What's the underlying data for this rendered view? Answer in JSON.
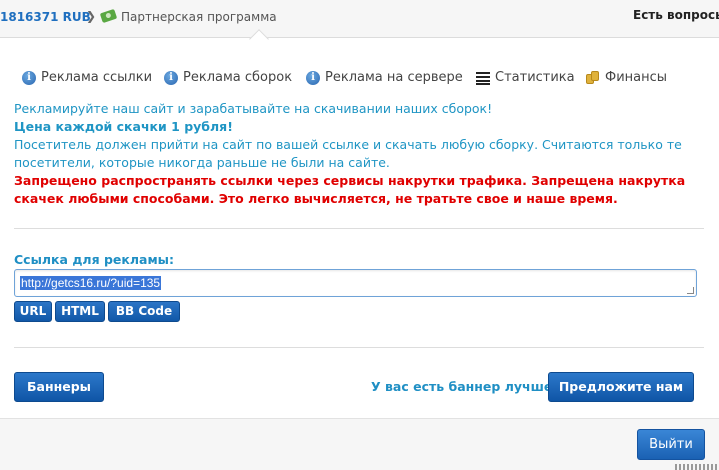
{
  "header": {
    "balance": "1816371 RUB",
    "separator": "❯",
    "breadcrumb_label": "Партнерская программа",
    "question_link": "Есть вопросы"
  },
  "tabs": [
    {
      "label": "Реклама ссылки",
      "icon": "info-icon"
    },
    {
      "label": "Реклама сборок",
      "icon": "info-icon"
    },
    {
      "label": "Реклама на сервере",
      "icon": "info-icon"
    },
    {
      "label": "Статистика",
      "icon": "list-icon"
    },
    {
      "label": "Финансы",
      "icon": "coins-icon"
    }
  ],
  "info": {
    "line1": "Рекламируйте наш сайт и зарабатывайте на скачивании наших сборок!",
    "line2": "Цена каждой скачки 1 рубля!",
    "line3": "Посетитель должен прийти на сайт по вашей ссылке и скачать любую сборку. Считаются только те посетители, которые никогда раньше не были на сайте.",
    "warning": "Запрещено распространять ссылки через сервисы накрутки трафика. Запрещена накрутка скачек любыми способами. Это легко вычисляется, не тратьте свое и наше время."
  },
  "link": {
    "label": "Ссылка для рекламы:",
    "value": "http://getcs16.ru/?uid=135"
  },
  "format_buttons": {
    "url": "URL",
    "html": "HTML",
    "bbcode": "BB Code"
  },
  "banners": {
    "button": "Баннеры",
    "question": "У вас есть баннер лучше?",
    "suggest_button": "Предложите нам"
  },
  "footer": {
    "exit_button": "Выйти"
  },
  "colors": {
    "accent_blue": "#1f95c4",
    "button_blue": "#1158a8",
    "warning_red": "#e00000"
  }
}
